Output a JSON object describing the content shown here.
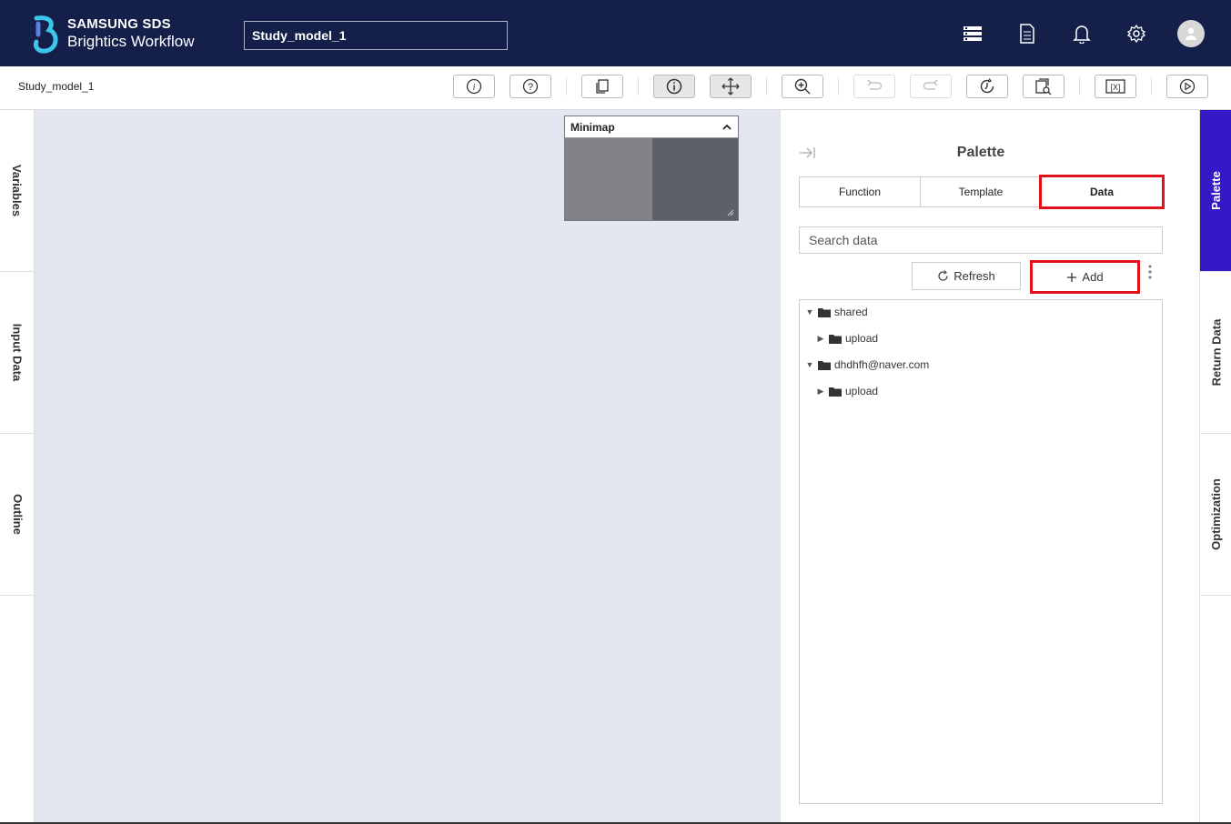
{
  "header": {
    "brand_line1": "SAMSUNG SDS",
    "brand_line2": "Brightics Workflow",
    "model_title": "Study_model_1",
    "icons": [
      "server-icon",
      "document-icon",
      "bell-icon",
      "gear-icon",
      "user-avatar-icon"
    ]
  },
  "toolbar": {
    "breadcrumb": "Study_model_1",
    "buttons": [
      "info-icon",
      "help-icon",
      "copy-icon",
      "info-toggle-icon",
      "move-icon",
      "zoom-in-icon",
      "undo-icon",
      "redo-icon",
      "history-icon",
      "search-file-icon",
      "variable-icon",
      "run-icon"
    ]
  },
  "left_tabs": [
    "Variables",
    "Input Data",
    "Outline"
  ],
  "minimap": {
    "title": "Minimap"
  },
  "palette": {
    "title": "Palette",
    "tabs": [
      "Function",
      "Template",
      "Data"
    ],
    "selected_tab": "Data",
    "search_placeholder": "Search data",
    "refresh_label": "Refresh",
    "add_label": "Add",
    "tree": [
      {
        "label": "shared",
        "expanded": true
      },
      {
        "label": "upload",
        "expanded": false
      },
      {
        "label": "dhdhfh@naver.com",
        "expanded": true
      },
      {
        "label": "upload",
        "expanded": false
      }
    ]
  },
  "right_tabs": [
    "Palette",
    "Return Data",
    "Optimization"
  ],
  "colors": {
    "header_bg": "#14204a",
    "accent": "#3519c7",
    "highlight": "#e0101c",
    "canvas_bg": "#e4e7ef"
  }
}
